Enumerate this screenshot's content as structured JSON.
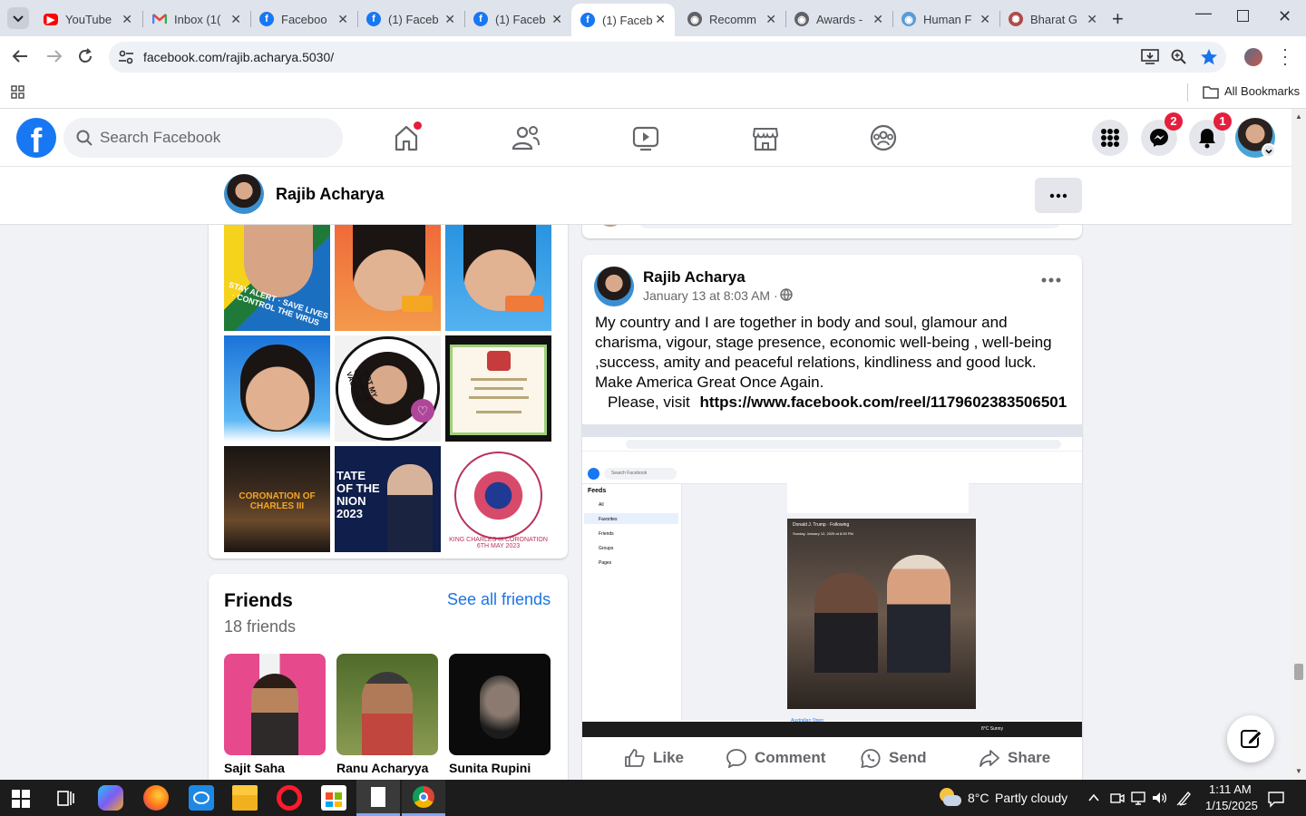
{
  "browser": {
    "tabs": [
      {
        "title": "YouTube",
        "icon": "youtube-icon"
      },
      {
        "title": "Inbox (1(",
        "icon": "gmail-icon"
      },
      {
        "title": "Faceboo",
        "icon": "facebook-icon"
      },
      {
        "title": "(1) Faceb",
        "icon": "facebook-icon"
      },
      {
        "title": "(1) Faceb",
        "icon": "facebook-icon"
      },
      {
        "title": "(1) Faceb",
        "icon": "facebook-icon"
      },
      {
        "title": "Recomm",
        "icon": "globe-icon"
      },
      {
        "title": "Awards -",
        "icon": "globe-icon"
      },
      {
        "title": "Human F",
        "icon": "globe-icon"
      },
      {
        "title": "Bharat G",
        "icon": "emblem-icon"
      }
    ],
    "url": "facebook.com/rajib.acharya.5030/",
    "bookmarks_label": "All Bookmarks"
  },
  "fb": {
    "search_placeholder": "Search Facebook",
    "messenger_badge": "2",
    "notifications_badge": "1"
  },
  "profile": {
    "name": "Rajib Acharya"
  },
  "photos": {
    "tiles": [
      {
        "caption": "STAY ALERT · SAVE LIVES · CONTROL THE VIRUS"
      },
      {
        "caption": ""
      },
      {
        "caption": ""
      },
      {
        "caption": ""
      },
      {
        "caption": "I GOT MY COVID-19 VACCINE"
      },
      {
        "caption": ""
      },
      {
        "caption": "CORONATION OF CHARLES III"
      },
      {
        "caption": "TATE OF THE NION 2023"
      },
      {
        "caption": "KING CHARLES III CORONATION 6TH MAY 2023"
      }
    ]
  },
  "friends": {
    "title": "Friends",
    "count": "18 friends",
    "see_all": "See all friends",
    "list": [
      {
        "name": "Sajit Saha"
      },
      {
        "name": "Ranu Acharyya"
      },
      {
        "name": "Sunita Rupini"
      }
    ]
  },
  "post": {
    "author": "Rajib Acharya",
    "time": "January 13 at 8:03 AM",
    "separator": "·",
    "text_line1": "My country and I are together in body and soul,  glamour and charisma, vigour, stage presence, economic well-being , well-being ,success, amity and peaceful relations, kindliness and good luck.",
    "text_line2": "Make America Great Once Again.",
    "text_line3_prefix": "Please, visit",
    "text_link": "https://www.facebook.com/reel/1179602383506501",
    "actions": {
      "like": "Like",
      "comment": "Comment",
      "send": "Send",
      "share": "Share"
    },
    "screenshot": {
      "feeds_title": "Feeds",
      "feeds_items": [
        "All",
        "Favorites",
        "Friends",
        "Groups",
        "Pages"
      ],
      "inner_post_author": "Donald J. Trump · Following",
      "inner_post_date": "Sunday, January 12, 2025 at 8:39 PM",
      "inner_search": "Search Facebook",
      "inner_footer": "Australian Open",
      "inner_weather": "8°C Sunny"
    }
  },
  "taskbar": {
    "weather_temp": "8°C",
    "weather_desc": "Partly cloudy",
    "time": "1:11 AM",
    "date": "1/15/2025"
  },
  "colors": {
    "fb_blue": "#1877f2",
    "badge_red": "#e41e3f",
    "link_blue": "#1b74e4"
  }
}
